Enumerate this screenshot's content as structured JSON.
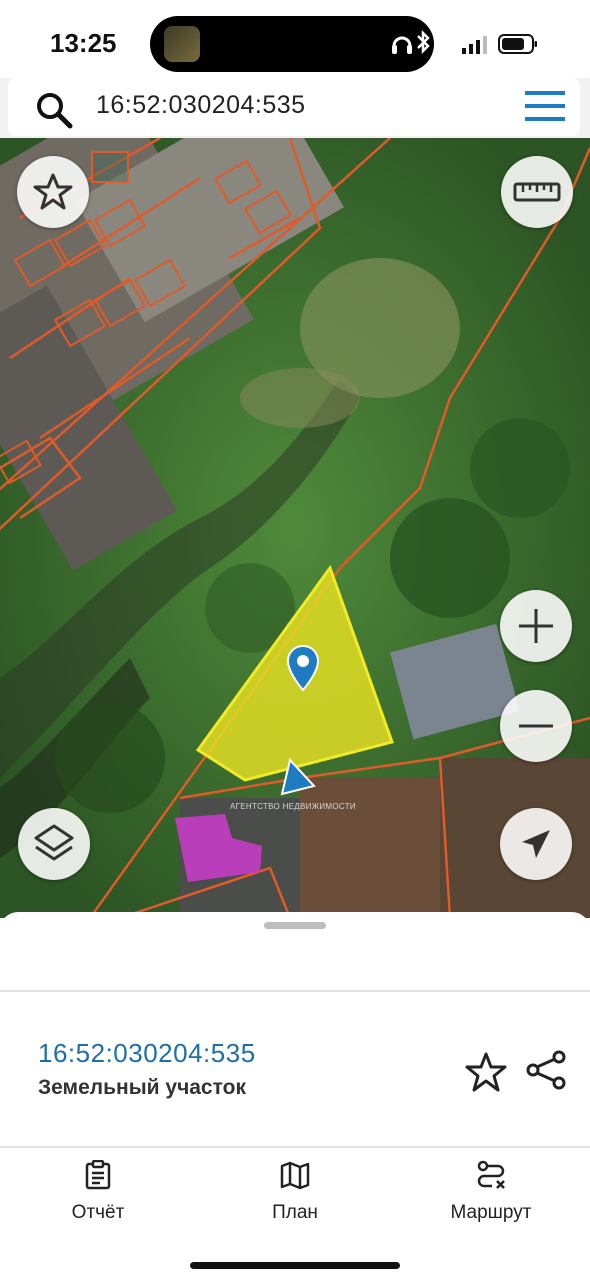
{
  "status_bar": {
    "time": "13:25"
  },
  "search": {
    "query": "16:52:030204:535"
  },
  "map": {
    "watermark": "АГЕНТСТВО НЕДВИЖИМОСТИ",
    "controls": {
      "favorite": "star-icon",
      "ruler": "ruler-icon",
      "zoom_in": "plus-icon",
      "zoom_out": "minus-icon",
      "layers": "layers-icon",
      "locate": "navigation-arrow-icon"
    },
    "colors": {
      "selected_parcel": "#e6e022",
      "parcel_border": "#e05a2a",
      "highlight_building": "#c83cc8",
      "location_marker": "#1f7bc2"
    }
  },
  "parcel": {
    "id": "16:52:030204:535",
    "type": "Земельный участок"
  },
  "bottom_nav": {
    "items": [
      {
        "label": "Отчёт",
        "icon": "clipboard-icon"
      },
      {
        "label": "План",
        "icon": "map-icon"
      },
      {
        "label": "Маршрут",
        "icon": "route-icon"
      }
    ]
  }
}
